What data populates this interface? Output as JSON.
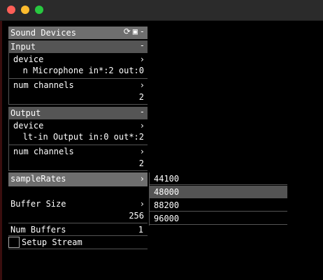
{
  "panel": {
    "title": "Sound Devices",
    "refresh_icon": "⟳",
    "save_icon": "▣",
    "minus": "-"
  },
  "input": {
    "header": "Input",
    "minus": "-",
    "device_label": "device",
    "device_value": "n Microphone in*:2 out:0",
    "channels_label": "num channels",
    "channels_value": "2"
  },
  "output": {
    "header": "Output",
    "minus": "-",
    "device_label": "device",
    "device_value": "lt-in Output in:0 out*:2",
    "channels_label": "num channels",
    "channels_value": "2"
  },
  "sample_rates": {
    "label": "sampleRates",
    "options": [
      "44100",
      "48000",
      "88200",
      "96000"
    ],
    "selected_index": 1
  },
  "buffer": {
    "size_label": "Buffer Size",
    "size_value": "256",
    "num_label": "Num Buffers",
    "num_value": "1"
  },
  "setup": {
    "label": "Setup Stream",
    "checked": false
  },
  "chevron": "›",
  "colors": {
    "background": "#000000",
    "header_main": "#6e6e6e",
    "header_section": "#555555",
    "selected_option": "#545454",
    "titlebar": "#2b2b2b"
  }
}
